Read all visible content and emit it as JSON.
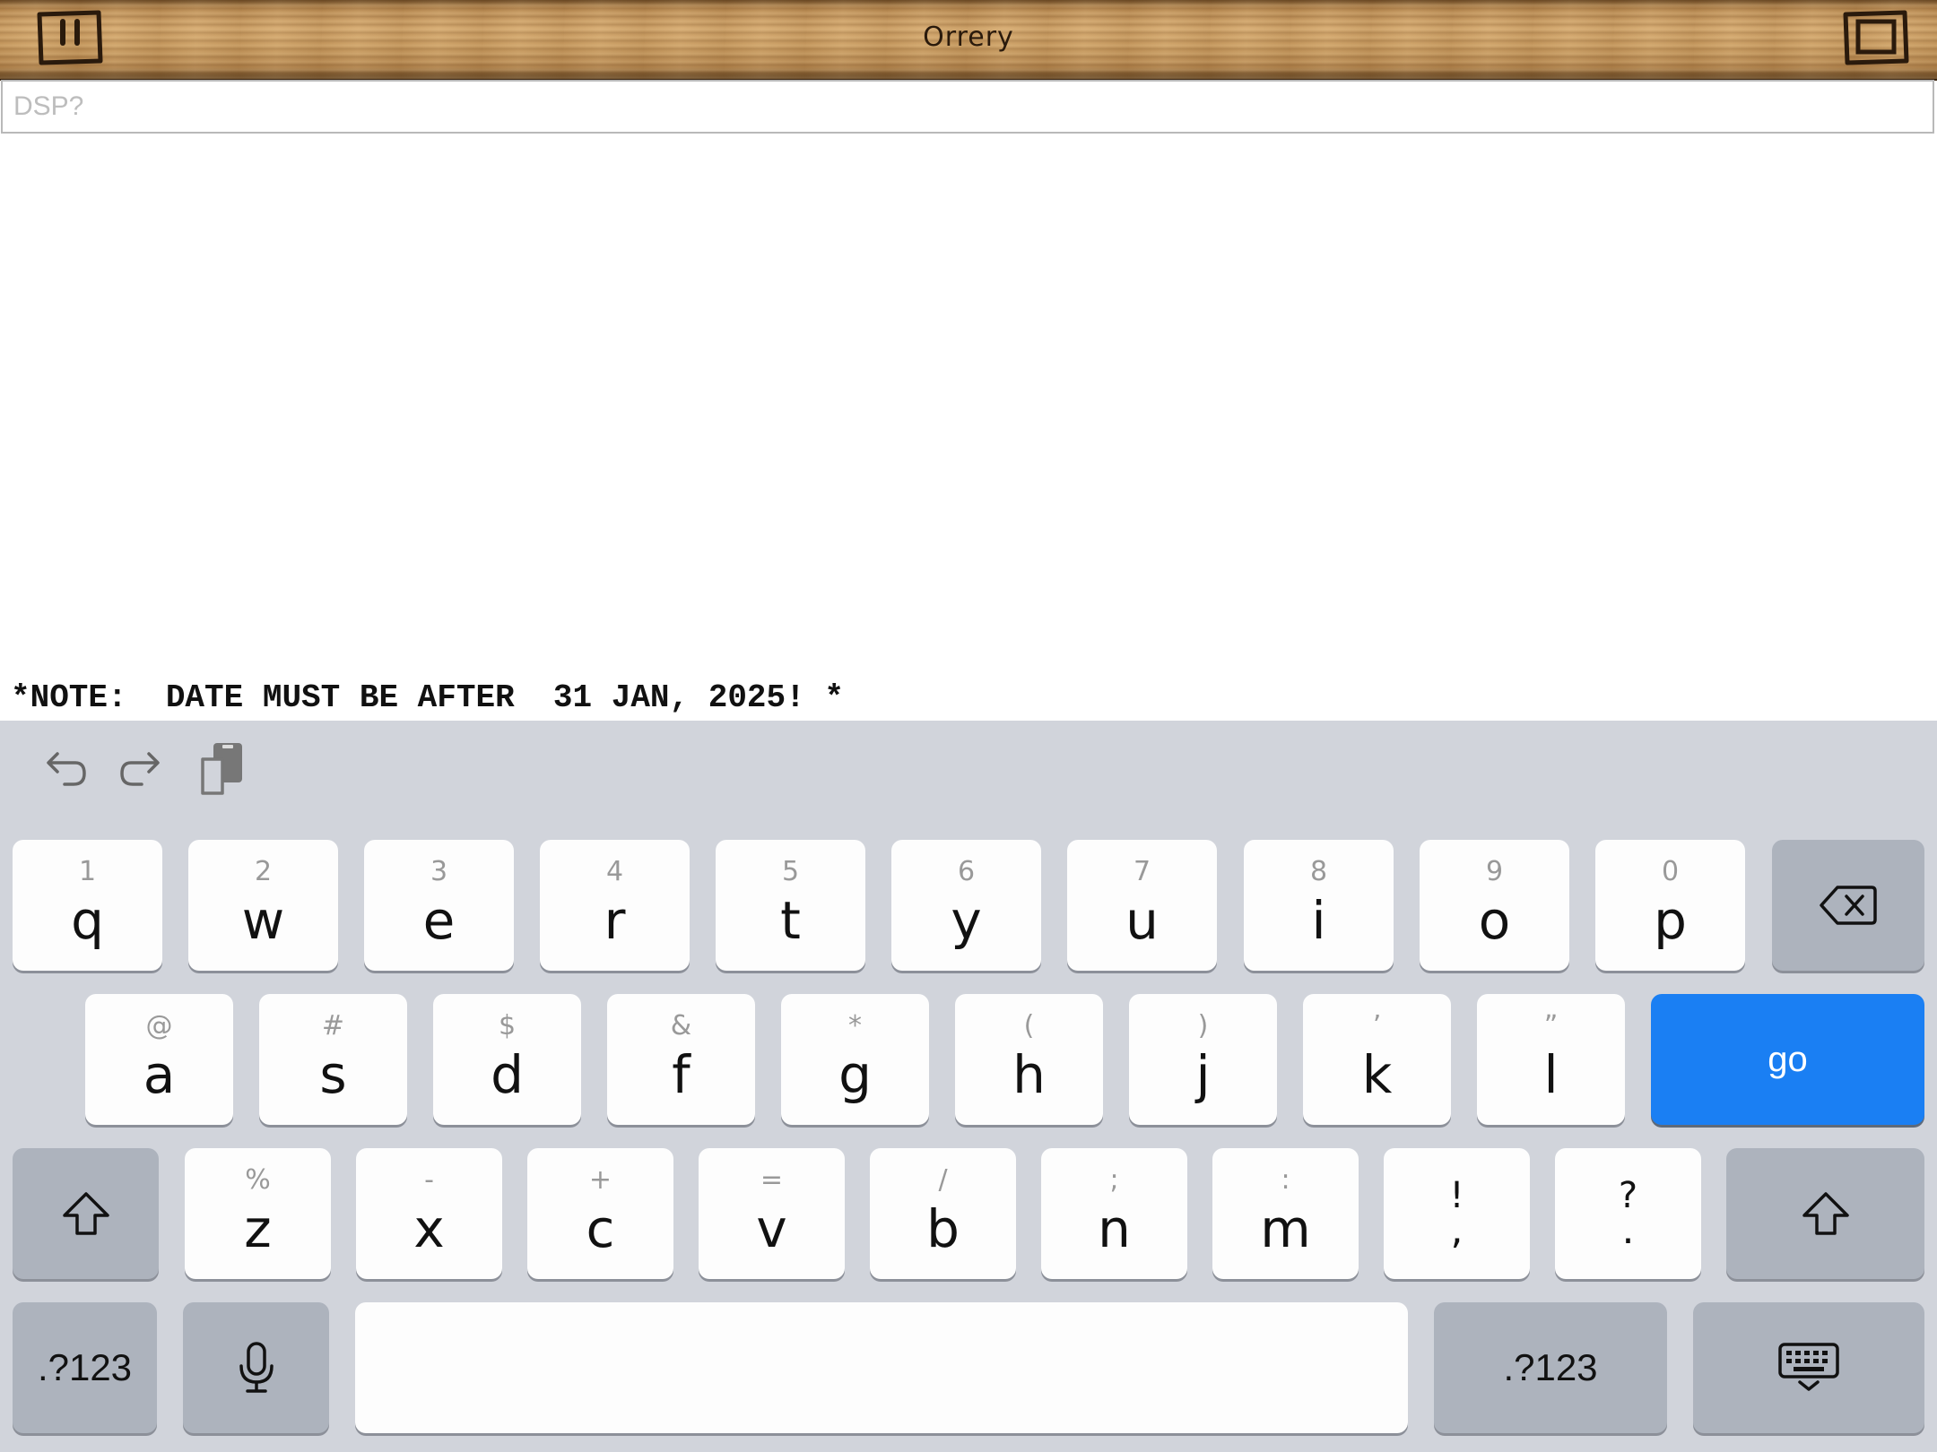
{
  "window": {
    "title": "Orrery"
  },
  "titlebar": {
    "left_icon": "pause-icon",
    "right_icon": "fullscreen-icon"
  },
  "command": {
    "placeholder": "DSP?",
    "value": ""
  },
  "output": {
    "note": "*NOTE:  DATE MUST BE AFTER  31 JAN, 2025! *"
  },
  "keyboard": {
    "shortcuts": [
      "undo-icon",
      "redo-icon",
      "paste-icon"
    ],
    "row1": [
      {
        "main": "q",
        "sub": "1"
      },
      {
        "main": "w",
        "sub": "2"
      },
      {
        "main": "e",
        "sub": "3"
      },
      {
        "main": "r",
        "sub": "4"
      },
      {
        "main": "t",
        "sub": "5"
      },
      {
        "main": "y",
        "sub": "6"
      },
      {
        "main": "u",
        "sub": "7"
      },
      {
        "main": "i",
        "sub": "8"
      },
      {
        "main": "o",
        "sub": "9"
      },
      {
        "main": "p",
        "sub": "0"
      }
    ],
    "row2": [
      {
        "main": "a",
        "sub": "@"
      },
      {
        "main": "s",
        "sub": "#"
      },
      {
        "main": "d",
        "sub": "$"
      },
      {
        "main": "f",
        "sub": "&"
      },
      {
        "main": "g",
        "sub": "*"
      },
      {
        "main": "h",
        "sub": "("
      },
      {
        "main": "j",
        "sub": ")"
      },
      {
        "main": "k",
        "sub": "’"
      },
      {
        "main": "l",
        "sub": "”"
      }
    ],
    "row3": [
      {
        "main": "z",
        "sub": "%"
      },
      {
        "main": "x",
        "sub": "-"
      },
      {
        "main": "c",
        "sub": "+"
      },
      {
        "main": "v",
        "sub": "="
      },
      {
        "main": "b",
        "sub": "/"
      },
      {
        "main": "n",
        "sub": ";"
      },
      {
        "main": "m",
        "sub": ":"
      }
    ],
    "punct": [
      {
        "top": "!",
        "bottom": ","
      },
      {
        "top": "?",
        "bottom": "."
      }
    ],
    "go_label": "go",
    "numbers_label": ".?123",
    "colors": {
      "go": "#1a7ff3",
      "background": "#d1d4db"
    }
  }
}
